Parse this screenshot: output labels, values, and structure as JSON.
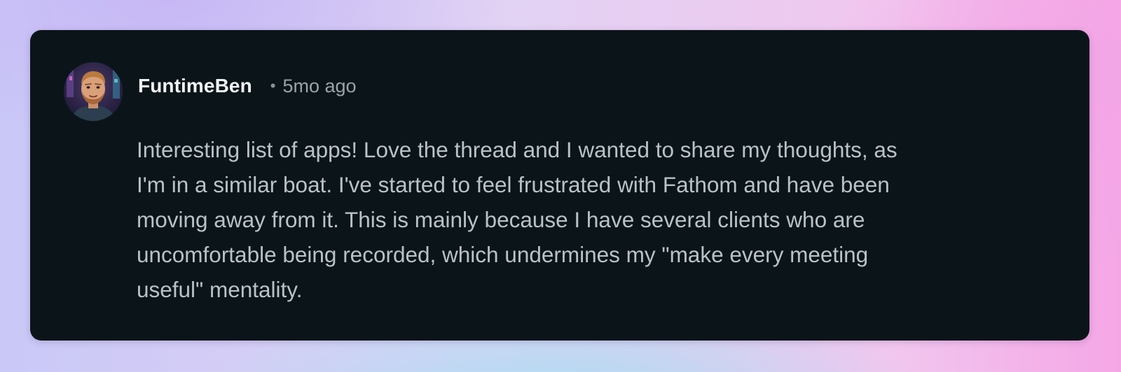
{
  "comment": {
    "avatar_icon": "user-avatar",
    "username": "FuntimeBen",
    "separator": "•",
    "timestamp": "5mo ago",
    "lines": [
      "Interesting list of apps! Love the thread and I wanted to share my thoughts, as",
      "I'm in a similar boat. I've started to feel frustrated with Fathom and have been",
      "moving away from it. This is mainly because I have several clients who are",
      "uncomfortable being recorded, which undermines my \"make every meeting",
      "useful\" mentality."
    ]
  },
  "colors": {
    "card_background": "#0b1519",
    "username": "#f2f4f5",
    "body_text": "#b9c2c8",
    "meta_text": "#9aa3a8"
  }
}
